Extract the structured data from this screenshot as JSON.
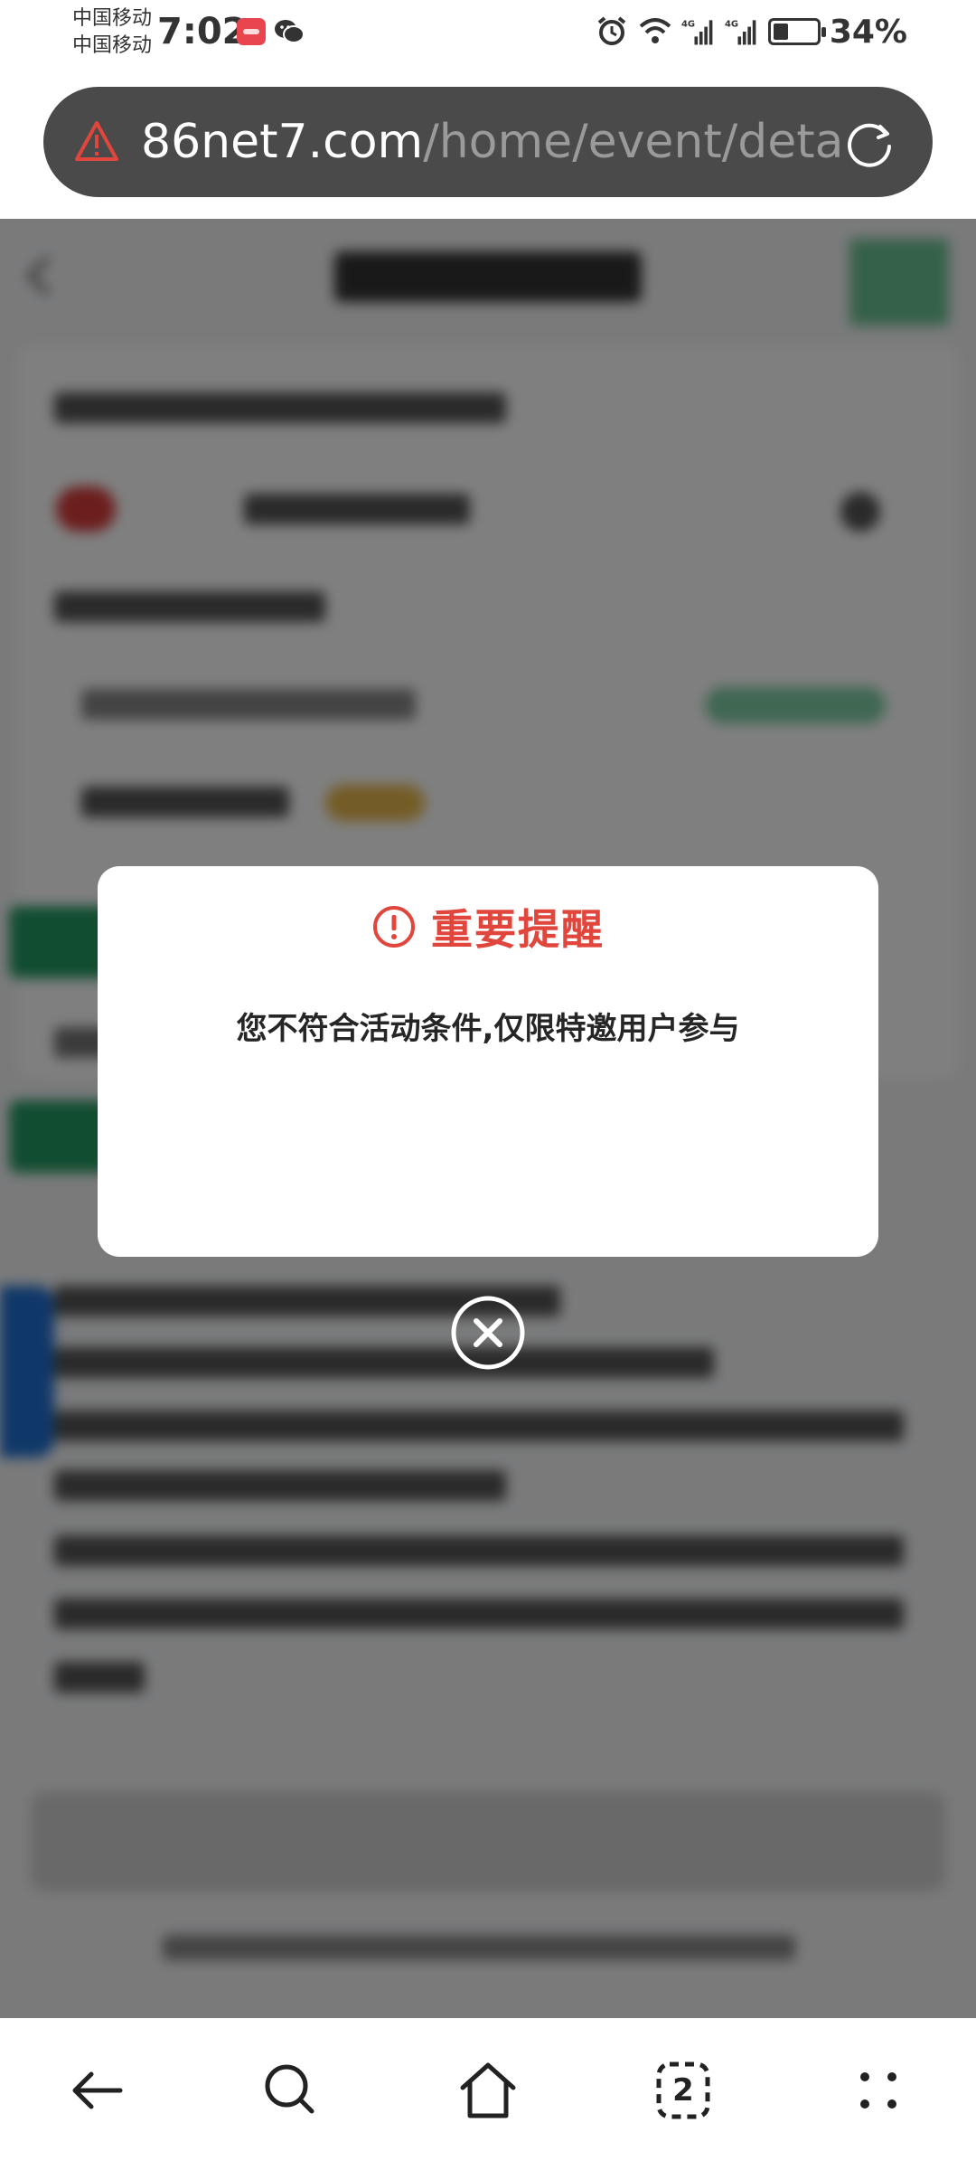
{
  "status_bar": {
    "carrier_1": "中国移动",
    "carrier_2": "中国移动",
    "time": "7:02",
    "network_1": "4G",
    "network_2": "4G",
    "battery_percent": "34%",
    "battery_level": 0.34,
    "icons": [
      "huawei-app-icon",
      "wechat-icon",
      "alarm-icon",
      "wifi-icon",
      "signal-icon",
      "signal-icon",
      "battery-charging-icon"
    ]
  },
  "browser": {
    "url_host": "86net7.com",
    "url_path": "/home/event/deta",
    "security_icon": "warning-triangle-icon",
    "reload_icon": "reload-icon"
  },
  "modal": {
    "title": "重要提醒",
    "message": "您不符合活动条件,仅限特邀用户参与",
    "title_color": "#e0463c",
    "close_icon": "close-circle-icon"
  },
  "nav_bar": {
    "back_icon": "arrow-left-icon",
    "search_icon": "search-icon",
    "home_icon": "home-icon",
    "tabs_count": "2",
    "menu_icon": "more-dots-icon"
  },
  "colors": {
    "url_bar_bg": "#4a4a4a",
    "warning": "#e0463c",
    "overlay": "rgba(0,0,0,0.5)"
  }
}
